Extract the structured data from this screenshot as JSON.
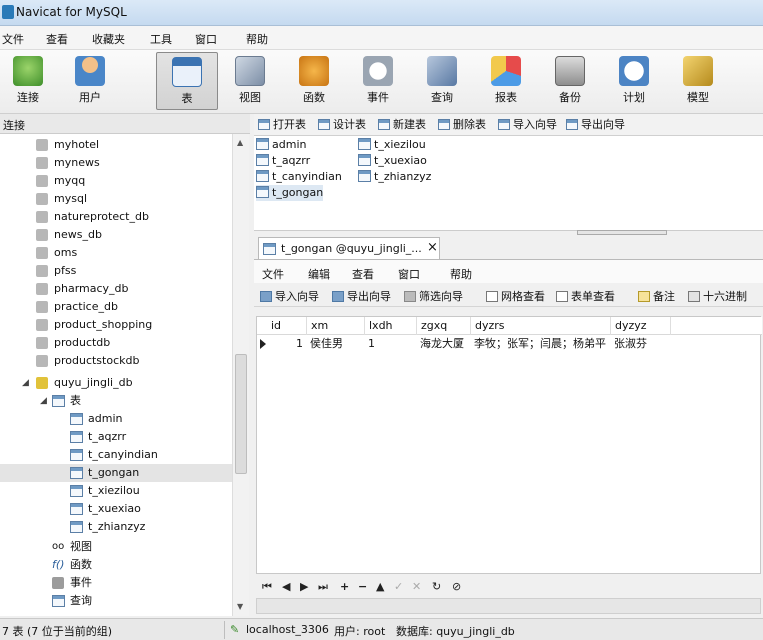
{
  "window": {
    "title": "Navicat for MySQL"
  },
  "menu": [
    "文件",
    "查看",
    "收藏夹",
    "工具",
    "窗口",
    "帮助"
  ],
  "toolbar": [
    {
      "label": "连接",
      "icon": "connection-icon"
    },
    {
      "label": "用户",
      "icon": "user-icon"
    },
    {
      "label": "表",
      "icon": "table-icon",
      "active": true
    },
    {
      "label": "视图",
      "icon": "view-icon"
    },
    {
      "label": "函数",
      "icon": "function-icon"
    },
    {
      "label": "事件",
      "icon": "event-icon"
    },
    {
      "label": "查询",
      "icon": "query-icon"
    },
    {
      "label": "报表",
      "icon": "report-icon"
    },
    {
      "label": "备份",
      "icon": "backup-icon"
    },
    {
      "label": "计划",
      "icon": "schedule-icon"
    },
    {
      "label": "模型",
      "icon": "model-icon"
    }
  ],
  "sidebar": {
    "header": "连接",
    "databases": [
      "myhotel",
      "mynews",
      "myqq",
      "mysql",
      "natureprotect_db",
      "news_db",
      "oms",
      "pfss",
      "pharmacy_db",
      "practice_db",
      "product_shopping",
      "productdb",
      "productstockdb"
    ],
    "open_db": "quyu_jingli_db",
    "tables_folder": "表",
    "tables": [
      "admin",
      "t_aqzrr",
      "t_canyindian",
      "t_gongan",
      "t_xiezilou",
      "t_xuexiao",
      "t_zhianzyz"
    ],
    "selected_table": "t_gongan",
    "other_folders": [
      "视图",
      "函数",
      "事件",
      "查询"
    ]
  },
  "object_toolbar": [
    "打开表",
    "设计表",
    "新建表",
    "删除表",
    "导入向导",
    "导出向导"
  ],
  "object_list": {
    "col1": [
      "admin",
      "t_aqzrr",
      "t_canyindian",
      "t_gongan"
    ],
    "col2": [
      "t_xiezilou",
      "t_xuexiao",
      "t_zhianzyz"
    ]
  },
  "doc_tab": {
    "label": "t_gongan @quyu_jingli_...",
    "close": "×"
  },
  "inner_menu": [
    "文件",
    "编辑",
    "查看",
    "窗口",
    "帮助"
  ],
  "inner_toolbar": [
    "导入向导",
    "导出向导",
    "筛选向导",
    "网格查看",
    "表单查看",
    "备注",
    "十六进制"
  ],
  "grid": {
    "columns": [
      "id",
      "xm",
      "lxdh",
      "zgxq",
      "dyzrs",
      "dyzyz"
    ],
    "rows": [
      [
        "1",
        "侯佳男",
        "1",
        "海龙大厦",
        "李牧；张军；闫晨；杨弟平",
        "张淑芬"
      ]
    ]
  },
  "nav_buttons": [
    "⏮",
    "◀",
    "▶",
    "⏭",
    "+",
    "−",
    "▲",
    "✓",
    "✕",
    "↻",
    "⊘"
  ],
  "status": {
    "left": "7 表 (7 位于当前的组)",
    "host": "localhost_3306",
    "user": "用户: root",
    "db": "数据库: quyu_jingli_db"
  }
}
